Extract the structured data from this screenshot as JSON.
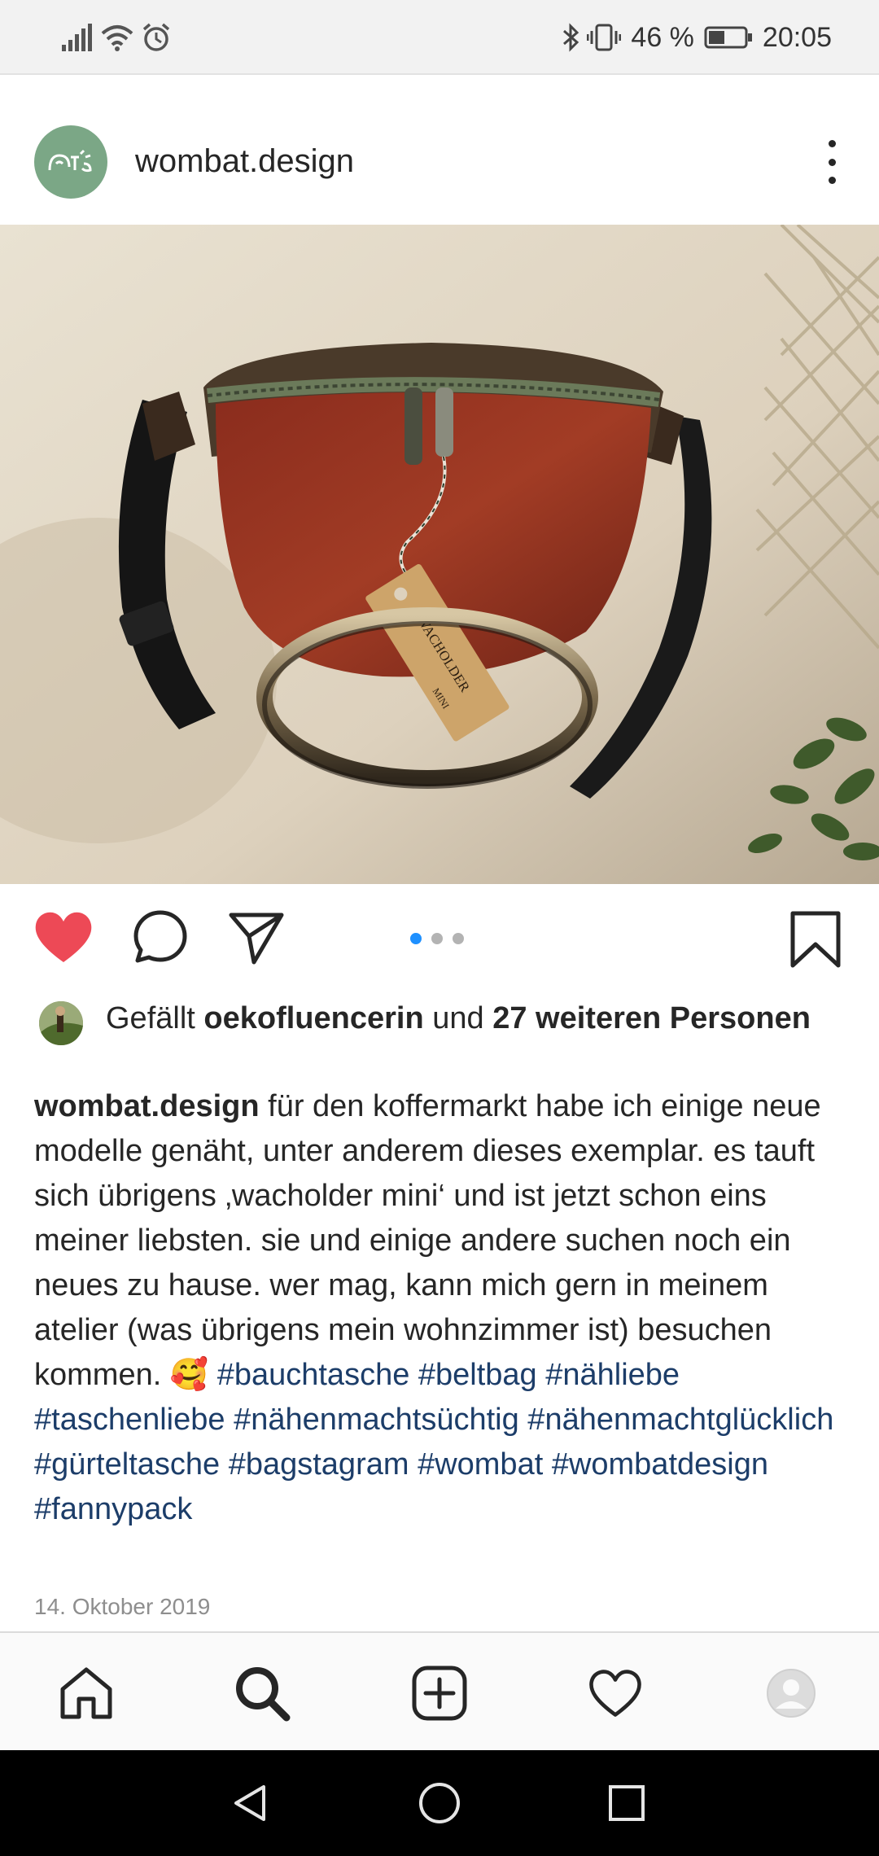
{
  "status_bar": {
    "battery_percent_text": "46 %",
    "battery_level": 0.46,
    "time": "20:05",
    "icons": [
      "signal-icon",
      "wifi-icon",
      "alarm-icon",
      "bluetooth-icon",
      "vibrate-icon",
      "battery-icon"
    ]
  },
  "post": {
    "username": "wombat.design",
    "image": {
      "tag_line1": "WACHOLDER",
      "tag_line2": "MINI"
    },
    "carousel": {
      "count": 3,
      "active": 0
    },
    "likes": {
      "prefix": "Gefällt",
      "liker": "oekofluencerin",
      "connector": "und",
      "others": "27 weiteren Personen"
    },
    "caption": {
      "user": "wombat.design",
      "text": "für den koffermarkt habe ich einige neue modelle genäht, unter anderem dieses exemplar. es tauft sich übrigens ‚wacholder mini‘ und ist jetzt schon eins meiner liebsten. sie und einige andere suchen noch ein neues zu hause. wer mag, kann mich gern in meinem atelier (was übrigens mein wohnzimmer ist) besuchen kommen. 🥰",
      "hashtags": "#bauchtasche #beltbag #nähliebe #taschenliebe #nähenmachtsüchtig #nähenmachtglücklich #gürteltasche #bagstagram #wombat #wombatdesign #fannypack"
    },
    "date": "14. Oktober 2019"
  },
  "colors": {
    "heart": "#ed4956",
    "hashtag": "#1c3d69",
    "active_dot": "#1e90ff",
    "avatar_bg": "#7ba786"
  }
}
